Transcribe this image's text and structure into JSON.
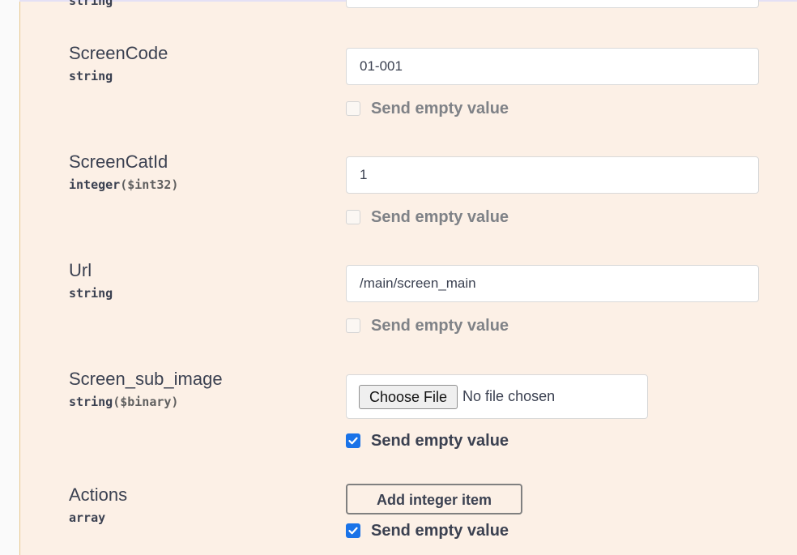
{
  "params": [
    {
      "name": "",
      "type": "string",
      "format": "",
      "value": ""
    },
    {
      "name": "ScreenCode",
      "type": "string",
      "format": "",
      "value": "01-001"
    },
    {
      "name": "ScreenCatId",
      "type": "integer",
      "format": "($int32)",
      "value": "1"
    },
    {
      "name": "Url",
      "type": "string",
      "format": "",
      "value": "/main/screen_main"
    },
    {
      "name": "Screen_sub_image",
      "type": "string",
      "format": "($binary)",
      "file_button": "Choose File",
      "file_status": "No file chosen"
    },
    {
      "name": "Actions",
      "type": "array",
      "format": "",
      "add_button": "Add integer item"
    }
  ],
  "send_empty_label": "Send empty value",
  "send_empty_states": [
    false,
    false,
    false,
    true,
    true
  ],
  "colors": {
    "panel_bg": "#fcf0e6",
    "checkbox_checked": "#1a73e8",
    "text": "#3b4151"
  }
}
